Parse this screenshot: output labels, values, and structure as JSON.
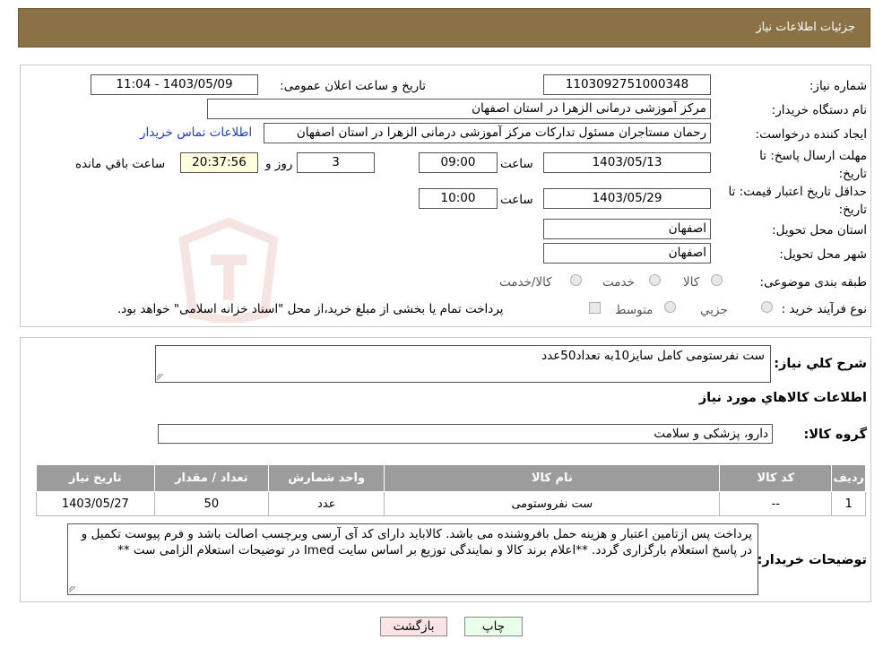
{
  "header": {
    "title": "جزئیات اطلاعات نیاز"
  },
  "form": {
    "need_number": {
      "label": "شماره نیاز:",
      "value": "1103092751000348"
    },
    "announce_datetime": {
      "label": "تاریخ و ساعت اعلان عمومی:",
      "value": "1403/05/09 - 11:04"
    },
    "buyer_org": {
      "label": "نام دستگاه خريدار:",
      "value": "مرکز آموزشی درمانی الزهرا در استان اصفهان"
    },
    "requester": {
      "label": "ايجاد کننده درخواست:",
      "value": "رحمان مستاجران مسئول تدارکات مرکز آموزشی درمانی الزهرا در استان اصفهان",
      "contact_link": "اطلاعات تماس خریدار"
    },
    "response_deadline": {
      "label": "مهلت ارسال پاسخ: تا تاریخ:",
      "date": "1403/05/13",
      "time_label": "ساعت",
      "time": "09:00",
      "days": "3",
      "days_label": "روز و",
      "remaining": "20:37:56",
      "remaining_label": "ساعت باقي مانده"
    },
    "price_validity": {
      "label": "حداقل تاريخ اعتبار قيمت: تا تاريخ:",
      "date": "1403/05/29",
      "time_label": "ساعت",
      "time": "10:00"
    },
    "delivery_province": {
      "label": "استان محل تحويل:",
      "value": "اصفهان"
    },
    "delivery_city": {
      "label": "شهر محل تحويل:",
      "value": "اصفهان"
    },
    "category": {
      "label": "طبقه بندی موضوعی:",
      "options": [
        "کالا",
        "خدمت",
        "کالا/خدمت"
      ]
    },
    "purchase_process": {
      "label": "نوع فرآیند خرید :",
      "options": [
        "جزيي",
        "متوسط"
      ],
      "note": "پرداخت تمام یا بخشی از مبلغ خرید،از محل \"اسناد خزانه اسلامی\" خواهد بود."
    }
  },
  "details": {
    "summary_label": "شرح کلي نياز:",
    "summary_value": "ست نفرستومی کامل سایز10به تعداد50عدد",
    "items_title": "اطلاعات کالاهاي مورد نياز",
    "group_label": "گروه کالا:",
    "group_value": "دارو، پزشکی و سلامت",
    "table": {
      "headers": [
        "رديف",
        "کد کالا",
        "نام کالا",
        "واحد شمارش",
        "تعداد / مقدار",
        "تاريخ نياز"
      ],
      "rows": [
        [
          "1",
          "--",
          "ست نفروستومی",
          "عدد",
          "50",
          "1403/05/27"
        ]
      ]
    },
    "buyer_notes_label": "توضيحات خريدار:",
    "buyer_notes": "پرداخت پس ازتامین اعتبار و هزینه حمل بافروشنده می باشد. کالاباید دارای کد آی آرسی وبرچسب اصالت باشد و فرم پیوست تکمیل و در پاسخ استعلام بارگزاری گردد. **اعلام برند کالا و نمایندگی توزیع بر اساس سایت Imed در توضیحات استعلام الزامی ست **"
  },
  "buttons": {
    "print": "چاپ",
    "back": "بازگشت"
  },
  "colors": {
    "header_bg": "#8b7146",
    "table_header_bg": "#9c9c9c",
    "back_button_bg": "#fde4e4",
    "print_button_bg": "#eaffea",
    "remaining_bg": "#ffffe0"
  }
}
